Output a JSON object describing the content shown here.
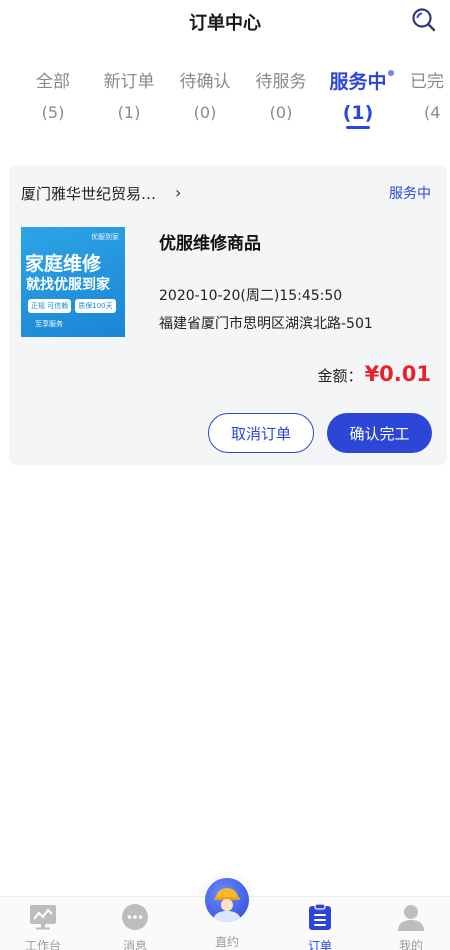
{
  "header": {
    "title": "订单中心",
    "search_icon": "search-icon"
  },
  "tabs": [
    {
      "label": "全部",
      "count": "(5)",
      "active": false
    },
    {
      "label": "新订单",
      "count": "(1)",
      "active": false
    },
    {
      "label": "待确认",
      "count": "(0)",
      "active": false
    },
    {
      "label": "待服务",
      "count": "(0)",
      "active": false
    },
    {
      "label": "服务中",
      "count": "(1)",
      "active": true
    },
    {
      "label": "已完",
      "count": "(4",
      "active": false
    }
  ],
  "order": {
    "store_name": "厦门雅华世纪贸易…",
    "arrow": "›",
    "status": "服务中",
    "image": {
      "brand": "优服到家",
      "line1": "家庭维修",
      "line2": "就找优服到家",
      "pill1": "正规 可信赖",
      "pill2": "质保100天",
      "foot": "至享服务"
    },
    "product_name": "优服维修商品",
    "time": "2020-10-20(周二)15:45:50",
    "address": "福建省厦门市思明区湖滨北路-501",
    "amount_label": "金额：",
    "amount_value": "¥0.01",
    "cancel_label": "取消订单",
    "confirm_label": "确认完工"
  },
  "tabbar": [
    {
      "label": "工作台",
      "icon": "workbench-icon",
      "active": false
    },
    {
      "label": "消息",
      "icon": "message-icon",
      "active": false
    },
    {
      "label": "直约",
      "icon": "worker-avatar-icon",
      "active": false
    },
    {
      "label": "订单",
      "icon": "order-list-icon",
      "active": true
    },
    {
      "label": "我的",
      "icon": "profile-icon",
      "active": false
    }
  ],
  "colors": {
    "accent": "#2c47d8",
    "price": "#e8222b",
    "muted": "#8a8a8a"
  }
}
